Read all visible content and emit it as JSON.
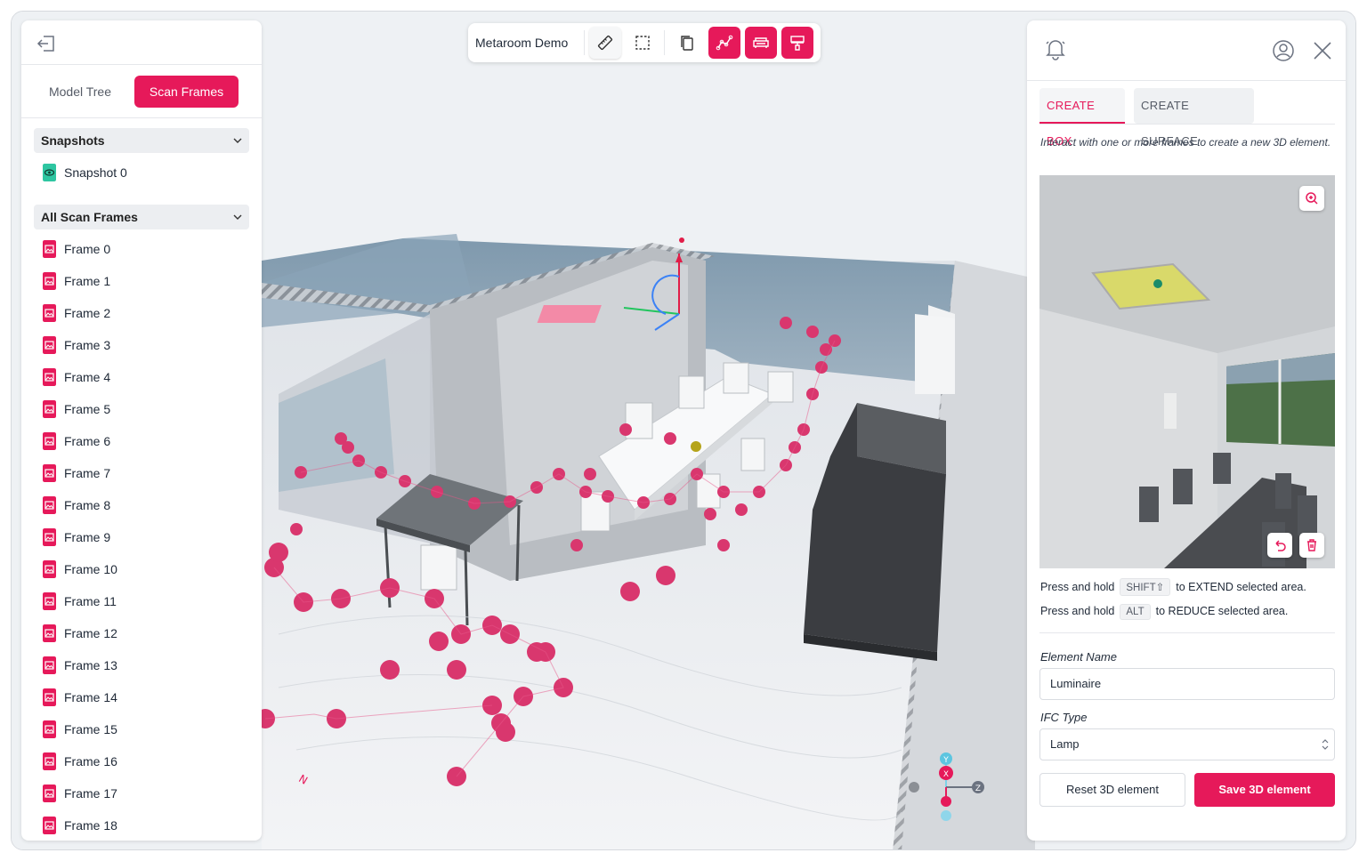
{
  "app": {
    "project_title": "Metaroom Demo"
  },
  "colors": {
    "accent": "#e6195a",
    "snapshot_green": "#2ec6a1",
    "frame_icon": "#e6195a"
  },
  "left_panel": {
    "tabs": [
      {
        "label": "Model Tree",
        "active": false
      },
      {
        "label": "Scan Frames",
        "active": true
      }
    ],
    "snapshots": {
      "header": "Snapshots",
      "items": [
        {
          "label": "Snapshot 0",
          "icon": "eye-icon"
        }
      ]
    },
    "scan_frames": {
      "header": "All Scan Frames",
      "items": [
        {
          "label": "Frame 0"
        },
        {
          "label": "Frame 1"
        },
        {
          "label": "Frame 2"
        },
        {
          "label": "Frame 3"
        },
        {
          "label": "Frame 4"
        },
        {
          "label": "Frame 5"
        },
        {
          "label": "Frame 6"
        },
        {
          "label": "Frame 7"
        },
        {
          "label": "Frame 8"
        },
        {
          "label": "Frame 9"
        },
        {
          "label": "Frame 10"
        },
        {
          "label": "Frame 11"
        },
        {
          "label": "Frame 12"
        },
        {
          "label": "Frame 13"
        },
        {
          "label": "Frame 14"
        },
        {
          "label": "Frame 15"
        },
        {
          "label": "Frame 16"
        },
        {
          "label": "Frame 17"
        },
        {
          "label": "Frame 18"
        }
      ]
    }
  },
  "toolbar": {
    "buttons": [
      {
        "icon": "ruler-icon",
        "style": "grey"
      },
      {
        "icon": "selection-icon",
        "style": "grey"
      },
      {
        "icon": "copy-icon",
        "style": "plain"
      },
      {
        "icon": "path-icon",
        "style": "red"
      },
      {
        "icon": "sofa-icon",
        "style": "red"
      },
      {
        "icon": "paint-roller-icon",
        "style": "red"
      }
    ]
  },
  "right_panel": {
    "tabs": [
      {
        "label": "CREATE BOX",
        "active": true
      },
      {
        "label": "CREATE SURFACE",
        "active": false
      }
    ],
    "description": "Interact with one or more frames to create a new 3D element.",
    "hints": [
      {
        "prefix": "Press and hold",
        "key": "SHIFT⇧",
        "suffix": "to EXTEND selected area."
      },
      {
        "prefix": "Press and hold",
        "key": "ALT",
        "suffix": "to REDUCE selected area."
      }
    ],
    "element_name": {
      "label": "Element Name",
      "value": "Luminaire"
    },
    "ifc_type": {
      "label": "IFC Type",
      "value": "Lamp"
    },
    "buttons": {
      "reset": "Reset 3D element",
      "save": "Save 3D element"
    }
  },
  "gizmo": {
    "labels": {
      "y": "Y",
      "x": "X",
      "z": "Z"
    }
  }
}
